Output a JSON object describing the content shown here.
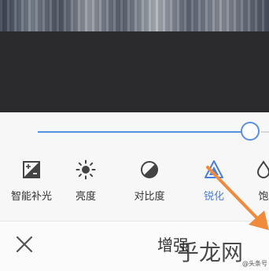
{
  "slider": {
    "value": 0.9
  },
  "tools": [
    {
      "label": "智能补光",
      "icon": "auto-light-icon"
    },
    {
      "label": "亮度",
      "icon": "sun-icon"
    },
    {
      "label": "对比度",
      "icon": "contrast-icon"
    },
    {
      "label": "锐化",
      "icon": "sharpen-triangle-icon",
      "active": true
    },
    {
      "label": "饱",
      "icon": "saturation-icon"
    }
  ],
  "bottom": {
    "title": "增强"
  },
  "watermark": {
    "text": "乎龙网",
    "small": "@头条号"
  },
  "colors": {
    "accent": "#4a7fe0",
    "arrow": "#f08a3c",
    "dark_band": "#2b2b2d"
  }
}
